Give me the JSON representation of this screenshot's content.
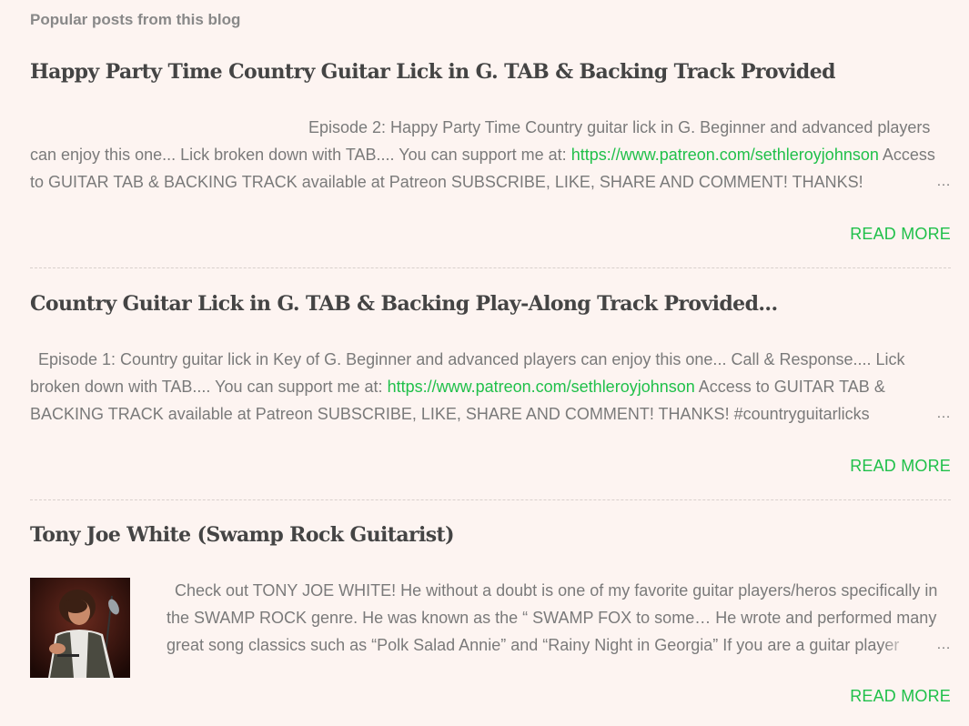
{
  "section": {
    "title": "Popular posts from this blog"
  },
  "posts": [
    {
      "title": "Happy Party Time Country Guitar Lick in G. TAB & Backing Track Provided",
      "snippet": {
        "before_link": "Episode 2: Happy Party Time Country guitar lick in G. Beginner and advanced players can enjoy this one... Lick broken down with TAB.... You can support me at: ",
        "link": "https://www.patreon.com/sethleroyjohnson",
        "after_link": " Access to GUITAR TAB & BACKING TRACK available at Patreon SUBSCRIBE, LIKE, SHARE AND COMMENT! THANKS!"
      },
      "ellipsis": "…",
      "read_more": "READ MORE"
    },
    {
      "title": "Country Guitar Lick in G. TAB & Backing Play-Along Track Provided...",
      "snippet": {
        "before_link": "Episode 1: Country guitar lick in Key of G. Beginner and advanced players can enjoy this one... Call & Response.... Lick broken down with TAB.... You can support me at: ",
        "link": "https://www.patreon.com/sethleroyjohnson",
        "after_link": " Access to GUITAR TAB & BACKING TRACK available at Patreon SUBSCRIBE, LIKE, SHARE AND COMMENT! THANKS! #countryguitarlicks"
      },
      "ellipsis": "…",
      "read_more": "READ MORE"
    },
    {
      "title": "Tony Joe White (Swamp Rock Guitarist)",
      "snippet": {
        "text": "Check out TONY JOE WHITE! He without a doubt is one of my favorite guitar players/heros specifically in the SWAMP ROCK genre. He was known as the “ SWAMP FOX to some…   He wrote and performed many great song classics such as “Polk Salad Annie” and “Rainy Night in Georgia” If you are a guitar player"
      },
      "thumbnail_icon": "guitarist-photo",
      "ellipsis": "…",
      "read_more": "READ MORE"
    }
  ],
  "colors": {
    "background": "#fdf4f1",
    "link": "#20c04a",
    "title": "#444444",
    "text": "#7a7a7a"
  }
}
